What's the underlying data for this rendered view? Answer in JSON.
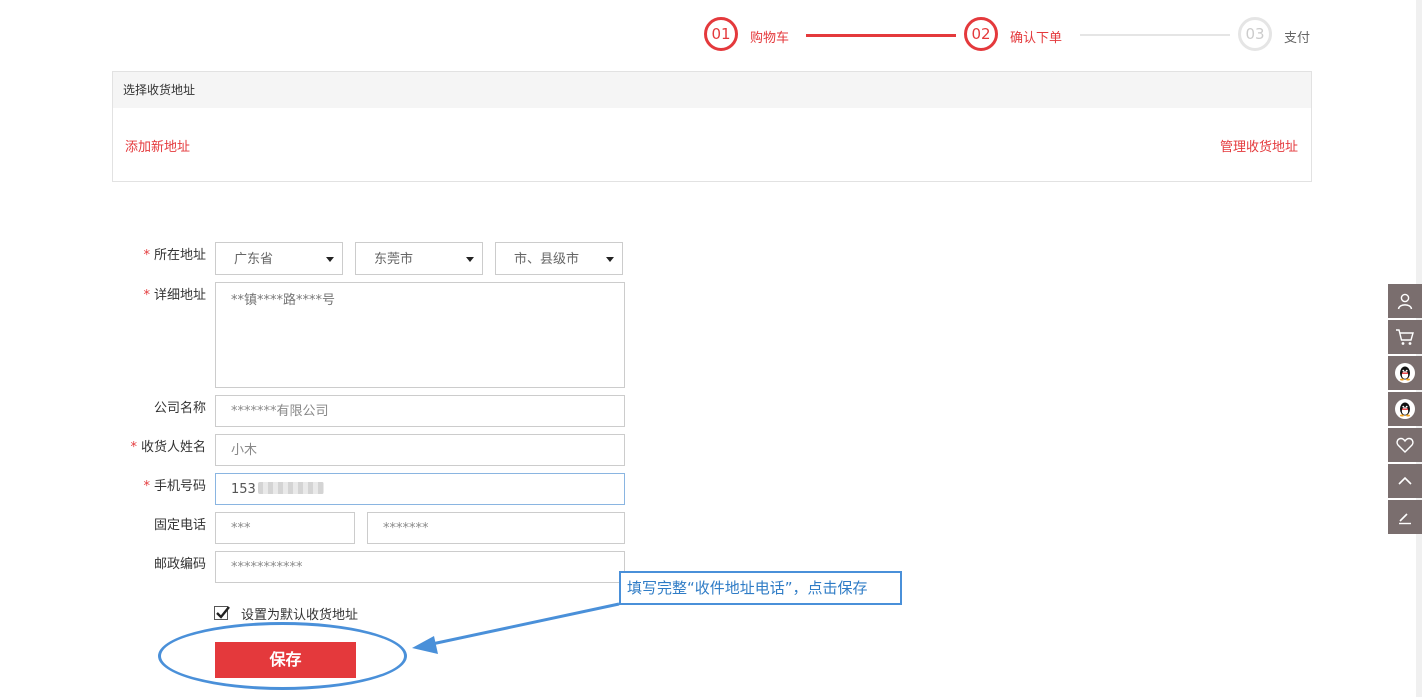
{
  "steps": [
    {
      "num": "01",
      "label": "购物车",
      "active": true
    },
    {
      "num": "02",
      "label": "确认下单",
      "active": true
    },
    {
      "num": "03",
      "label": "支付",
      "active": false
    }
  ],
  "address_box": {
    "title": "选择收货地址",
    "add_link": "添加新地址",
    "manage_link": "管理收货地址"
  },
  "form": {
    "region": {
      "label": "所在地址",
      "province": "广东省",
      "city": "东莞市",
      "district": "市、县级市"
    },
    "detail": {
      "label": "详细地址",
      "value": "**镇****路****号"
    },
    "company": {
      "label": "公司名称",
      "value": "*******有限公司"
    },
    "receiver": {
      "label": "收货人姓名",
      "value": "小木"
    },
    "mobile": {
      "label": "手机号码",
      "value": "153"
    },
    "landline": {
      "label": "固定电话",
      "area": "***",
      "number": "*******"
    },
    "zipcode": {
      "label": "邮政编码",
      "value": "***********"
    },
    "default_checkbox": {
      "label": "设置为默认收货地址",
      "checked": true
    },
    "required_mark": "*",
    "save_label": "保存"
  },
  "annotation": {
    "text": "填写完整“收件地址电话”，点击保存",
    "color": "#4a90d9"
  },
  "toolbar": {
    "icons": [
      "user-icon",
      "cart-icon",
      "qq-icon",
      "qq-icon",
      "heart-icon",
      "back-to-top-icon",
      "feedback-icon"
    ]
  },
  "colors": {
    "accent": "#e4393c",
    "inactive": "#e5e5e5",
    "toolbar_bg": "#7a6e6e"
  }
}
